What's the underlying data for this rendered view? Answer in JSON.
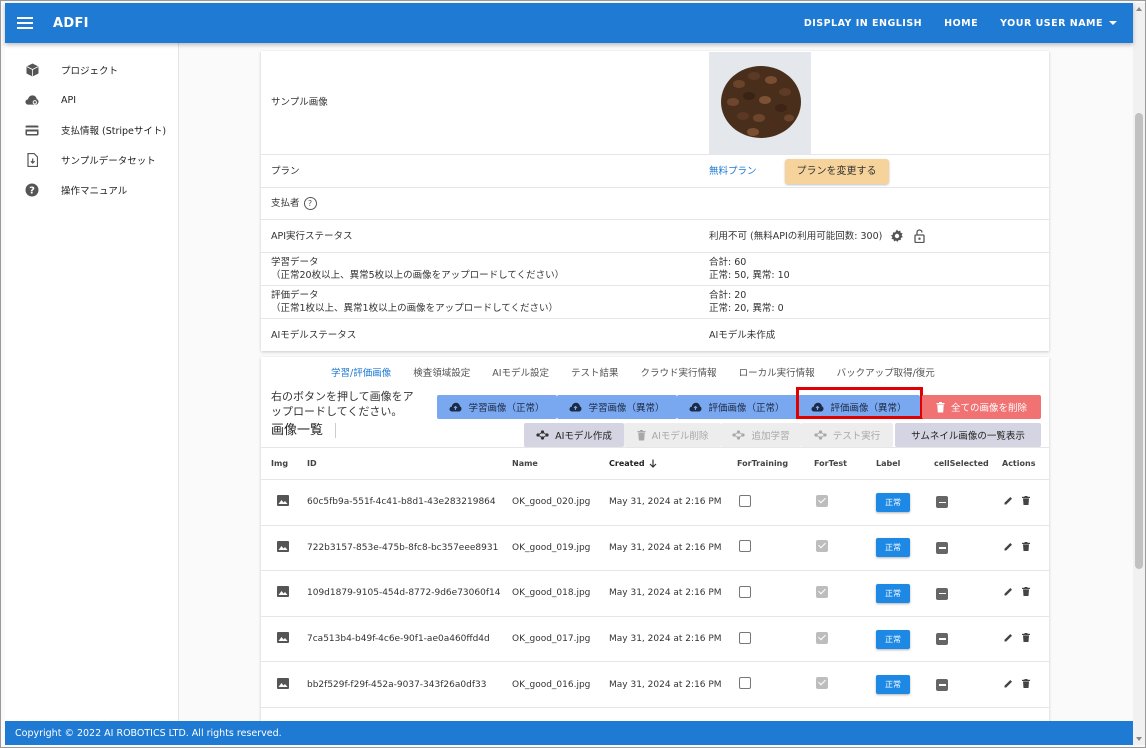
{
  "appbar": {
    "title": "ADFI",
    "display_english": "DISPLAY IN ENGLISH",
    "home": "HOME",
    "user_name": "YOUR USER NAME"
  },
  "sidebar": {
    "items": [
      {
        "label": "プロジェクト",
        "icon": "cube-icon"
      },
      {
        "label": "API",
        "icon": "cloud-gear-icon"
      },
      {
        "label": "支払情報 (Stripeサイト)",
        "icon": "credit-card-icon"
      },
      {
        "label": "サンプルデータセット",
        "icon": "download-file-icon"
      },
      {
        "label": "操作マニュアル",
        "icon": "help-icon"
      }
    ]
  },
  "info": {
    "sample_image_label": "サンプル画像",
    "plan_label": "プラン",
    "plan_value": "無料プラン",
    "plan_change_button": "プランを変更する",
    "payer_label": "支払者",
    "api_status_label": "API実行ステータス",
    "api_status_value": "利用不可 (無料APIの利用可能回数: 300)",
    "train_label": "学習データ",
    "train_hint": "（正常20枚以上、異常5枚以上の画像をアップロードしてください）",
    "train_total": "合計: 60",
    "train_detail": "正常: 50, 異常: 10",
    "eval_label": "評価データ",
    "eval_hint": "（正常1枚以上、異常1枚以上の画像をアップロードしてください）",
    "eval_total": "合計: 20",
    "eval_detail": "正常: 20, 異常: 0",
    "model_status_label": "AIモデルステータス",
    "model_status_value": "AIモデル未作成"
  },
  "tabs": [
    "学習/評価画像",
    "検査領域設定",
    "AIモデル設定",
    "テスト結果",
    "クラウド実行情報",
    "ローカル実行情報",
    "バックアップ取得/復元"
  ],
  "toolbar": {
    "instruction": "右のボタンを押して画像をアップロードしてください。",
    "list_title": "画像一覧",
    "upload_train_normal": "学習画像（正常）",
    "upload_train_abnormal": "学習画像（異常）",
    "upload_eval_normal": "評価画像（正常）",
    "upload_eval_abnormal": "評価画像（異常）",
    "delete_all": "全ての画像を削除",
    "create_model": "AIモデル作成",
    "delete_model": "AIモデル削除",
    "additional_training": "追加学習",
    "run_test": "テスト実行",
    "thumbnail_list": "サムネイル画像の一覧表示"
  },
  "table": {
    "headers": {
      "img": "Img",
      "id": "ID",
      "name": "Name",
      "created": "Created",
      "for_training": "ForTraining",
      "for_test": "ForTest",
      "label": "Label",
      "cell_selected": "cellSelected",
      "actions": "Actions"
    },
    "rows": [
      {
        "id": "60c5fb9a-551f-4c41-b8d1-43e283219864",
        "name": "OK_good_020.jpg",
        "created": "May 31, 2024 at 2:16 PM",
        "label": "正常"
      },
      {
        "id": "722b3157-853e-475b-8fc8-bc357eee8931",
        "name": "OK_good_019.jpg",
        "created": "May 31, 2024 at 2:16 PM",
        "label": "正常"
      },
      {
        "id": "109d1879-9105-454d-8772-9d6e73060f14",
        "name": "OK_good_018.jpg",
        "created": "May 31, 2024 at 2:16 PM",
        "label": "正常"
      },
      {
        "id": "7ca513b4-b49f-4c6e-90f1-ae0a460ffd4d",
        "name": "OK_good_017.jpg",
        "created": "May 31, 2024 at 2:16 PM",
        "label": "正常"
      },
      {
        "id": "bb2f529f-f29f-452a-9037-343f26a0df33",
        "name": "OK_good_016.jpg",
        "created": "May 31, 2024 at 2:16 PM",
        "label": "正常"
      }
    ]
  },
  "footer": {
    "copyright": "Copyright © 2022 AI ROBOTICS LTD. All rights reserved."
  },
  "colors": {
    "primary": "#1e7ad3",
    "upload_button": "#7aa8f0",
    "delete_button": "#f07272",
    "plan_button": "#f7d39c",
    "highlight": "#e00000"
  }
}
